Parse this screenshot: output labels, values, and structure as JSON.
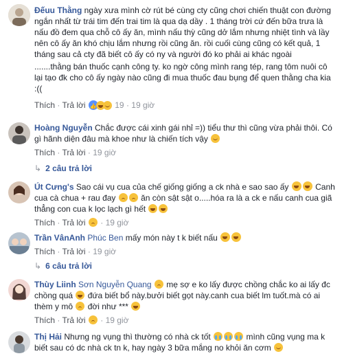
{
  "comments": [
    {
      "author": "Đếuu Thằng",
      "text_p1": "ngày xưa mình cờ rút bé cùng cty cũng chơi chiến thuật con đường ngắn nhất từ trái tim đến trai tim là qua dạ dầy . 1 tháng trời cứ đến bữa trưa là nấu đồ đem qua chỗ cô ấy ăn, mình nấu thỳ cũng dở lắm nhưng nhiệt tình và lầy nên cô ấy ăn khó chịu lắm nhưng rồi cũng ăn. rồi cuối cùng cũng có kết quả, 1 tháng sau cả cty đã biết cô ấy có ny và người đó ko phải ai khác ngoài",
      "text_p2": ".......thằng bán thuốc cạnh công ty. ko ngờ công mình rang tép, rang tôm nuôi cô lại tạo đk cho cô ấy ngày nào cũng đi mua thuốc đau bụng để quen thằng cha kia :((",
      "like": "Thích",
      "reply": "Trả lời",
      "count": "19",
      "time": "19 giờ"
    },
    {
      "author": "Hoàng Nguyễn",
      "text": "Chắc được cái xinh gái nhỉ =)) tiểu thư thì cũng vừa phải thôi. Có gì hãnh diện đâu mà khoe như là chiến tích vậy",
      "like": "Thích",
      "reply": "Trả lời",
      "time": "19 giờ",
      "more": "2 câu trả lời"
    },
    {
      "author": "Út Cưng's",
      "text_a": "Sao cái vụ cua của chế giống giống a ck nhà e sao sao ấy",
      "text_b": "Canh cua cà chua + rau đay",
      "text_c": "ăn còn sật sật o.....hóa ra là a ck e nấu canh cua giã thẳng con cua k lọc lạch gì hết",
      "like": "Thích",
      "reply": "Trả lời",
      "time": "19 giờ"
    },
    {
      "author": "Trần VânAnh",
      "tag": "Phúc Ben",
      "text": "mấy món này t k biết nấu",
      "like": "Thích",
      "reply": "Trả lời",
      "time": "19 giờ",
      "more": "6 câu trả lời"
    },
    {
      "author": "Thùy Liinh",
      "tag": "Sơn Nguyễn Quang",
      "text_a": "mẹ sợ e ko lấy được chồng chắc ko ai lấy đc chồng quá",
      "text_b": "đứa biết bổ này.bưởi biết gọt này.canh cua biết lm tuốt.mà có ai thèm y mô",
      "text_c": "đời như ***",
      "like": "Thích",
      "reply": "Trả lời",
      "time": "19 giờ"
    },
    {
      "author": "Thị Hải",
      "text_a": "Nhưng ng vụng thì thường có nhà ck tốt",
      "text_b": "mình cũng vụng ma k biết sau có dc nhà ck tn k, hay ngày 3 bữa mắng no khỏi ăn cơm"
    }
  ],
  "colors": {
    "link": "#365899",
    "meta": "#90949c",
    "emoji": "#f7c23b"
  }
}
